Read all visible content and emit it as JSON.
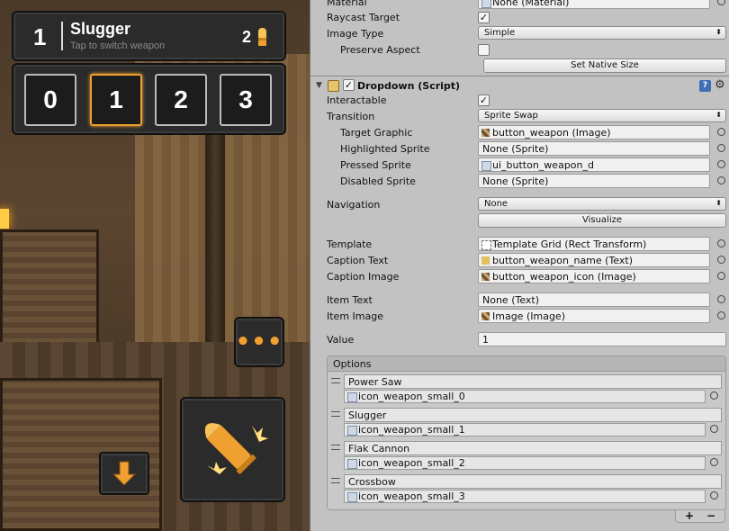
{
  "game": {
    "hud": {
      "weapon_number": "1",
      "weapon_name": "Slugger",
      "hint": "Tap to switch weapon",
      "ammo": "2",
      "slots": [
        "0",
        "1",
        "2",
        "3"
      ],
      "active_slot": 1,
      "more_label": "•••"
    }
  },
  "inspector": {
    "top_rows": {
      "material_label": "Material",
      "material_value": "None (Material)",
      "raycast_label": "Raycast Target",
      "raycast_checked": true,
      "image_type_label": "Image Type",
      "image_type_value": "Simple",
      "preserve_label": "Preserve Aspect",
      "preserve_checked": false,
      "native_size_label": "Set Native Size"
    },
    "component": {
      "title": "Dropdown (Script)",
      "enabled": true
    },
    "rows": {
      "interactable_label": "Interactable",
      "interactable_checked": true,
      "transition_label": "Transition",
      "transition_value": "Sprite Swap",
      "target_graphic_label": "Target Graphic",
      "target_graphic_value": "button_weapon (Image)",
      "highlighted_label": "Highlighted Sprite",
      "highlighted_value": "None (Sprite)",
      "pressed_label": "Pressed Sprite",
      "pressed_value": "ui_button_weapon_d",
      "disabled_label": "Disabled Sprite",
      "disabled_value": "None (Sprite)",
      "navigation_label": "Navigation",
      "navigation_value": "None",
      "visualize_label": "Visualize",
      "template_label": "Template",
      "template_value": "Template Grid (Rect Transform)",
      "caption_text_label": "Caption Text",
      "caption_text_value": "button_weapon_name (Text)",
      "caption_image_label": "Caption Image",
      "caption_image_value": "button_weapon_icon (Image)",
      "item_text_label": "Item Text",
      "item_text_value": "None (Text)",
      "item_image_label": "Item Image",
      "item_image_value": "Image (Image)",
      "value_label": "Value",
      "value_value": "1"
    },
    "options": {
      "label": "Options",
      "items": [
        {
          "text": "Power Saw",
          "image": "icon_weapon_small_0"
        },
        {
          "text": "Slugger",
          "image": "icon_weapon_small_1"
        },
        {
          "text": "Flak Cannon",
          "image": "icon_weapon_small_2"
        },
        {
          "text": "Crossbow",
          "image": "icon_weapon_small_3"
        }
      ],
      "add_label": "+",
      "remove_label": "−"
    }
  },
  "colors": {
    "accent": "#f0a030",
    "inspector_bg": "#c2c2c2",
    "hud_bg": "#2b2b2b"
  }
}
